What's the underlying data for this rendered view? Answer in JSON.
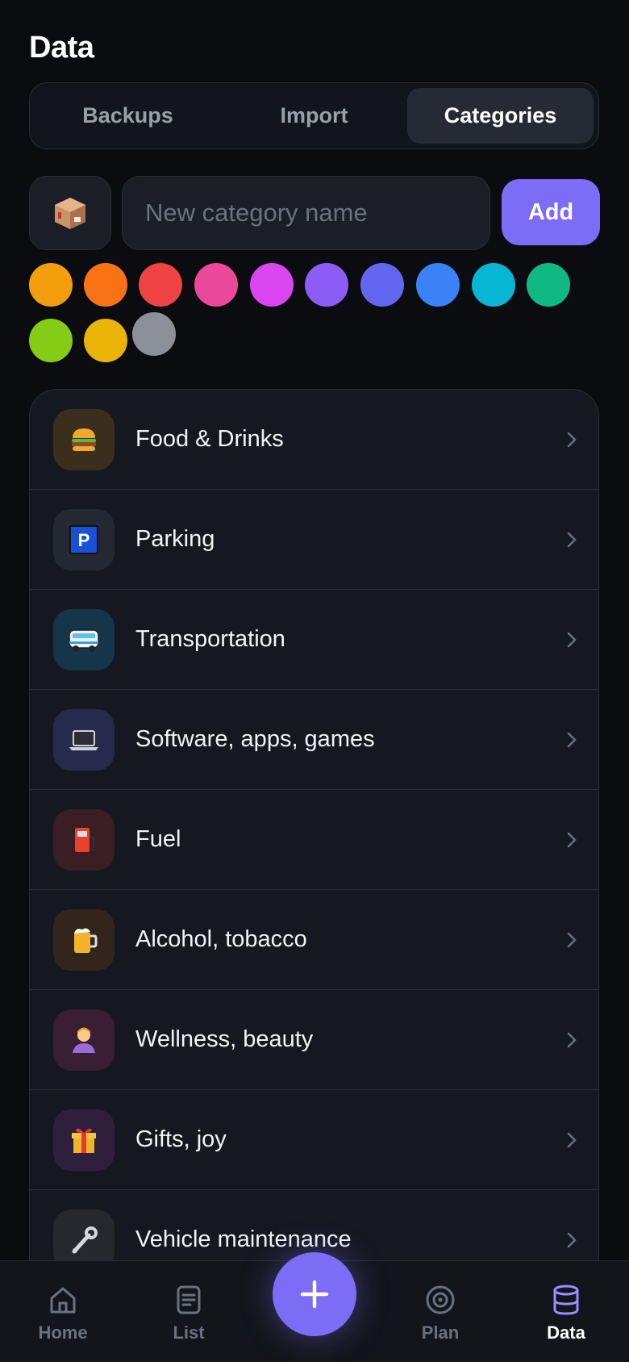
{
  "page": {
    "title": "Data"
  },
  "tabs": [
    {
      "label": "Backups",
      "active": false
    },
    {
      "label": "Import",
      "active": false
    },
    {
      "label": "Categories",
      "active": true
    }
  ],
  "new_category": {
    "emoji_icon": "package-icon",
    "placeholder": "New category name",
    "value": "",
    "add_label": "Add"
  },
  "colors": [
    {
      "hex": "#f59e0b",
      "selected": false
    },
    {
      "hex": "#f97316",
      "selected": false
    },
    {
      "hex": "#ef4444",
      "selected": false
    },
    {
      "hex": "#ec4899",
      "selected": false
    },
    {
      "hex": "#d946ef",
      "selected": false
    },
    {
      "hex": "#8b5cf6",
      "selected": false
    },
    {
      "hex": "#6366f1",
      "selected": false
    },
    {
      "hex": "#3b82f6",
      "selected": false
    },
    {
      "hex": "#06b6d4",
      "selected": false
    },
    {
      "hex": "#10b981",
      "selected": false
    },
    {
      "hex": "#84cc16",
      "selected": false
    },
    {
      "hex": "#eab308",
      "selected": false
    },
    {
      "hex": "#8b9099",
      "selected": true
    }
  ],
  "categories": [
    {
      "label": "Food & Drinks",
      "icon": "burger-icon",
      "bg": "#3a2e1c"
    },
    {
      "label": "Parking",
      "icon": "parking-icon",
      "bg": "#242833"
    },
    {
      "label": "Transportation",
      "icon": "bus-icon",
      "bg": "#15354a"
    },
    {
      "label": "Software, apps, games",
      "icon": "laptop-icon",
      "bg": "#262a4d"
    },
    {
      "label": "Fuel",
      "icon": "fuel-pump-icon",
      "bg": "#3b1e24"
    },
    {
      "label": "Alcohol, tobacco",
      "icon": "beer-mug-icon",
      "bg": "#33251c"
    },
    {
      "label": "Wellness, beauty",
      "icon": "spa-person-icon",
      "bg": "#3a1e33"
    },
    {
      "label": "Gifts, joy",
      "icon": "gift-icon",
      "bg": "#2f1f3d"
    },
    {
      "label": "Vehicle maintenance",
      "icon": "wrench-icon",
      "bg": "#26282d"
    }
  ],
  "bottom_nav": [
    {
      "label": "Home",
      "icon": "home-icon",
      "active": false
    },
    {
      "label": "List",
      "icon": "list-icon",
      "active": false
    },
    {
      "label": "Plan",
      "icon": "target-icon",
      "active": false
    },
    {
      "label": "Data",
      "icon": "database-icon",
      "active": true
    }
  ],
  "fab": {
    "icon": "plus-icon"
  },
  "theme": {
    "accent": "#7c6cf6",
    "background": "#0b0c10",
    "card": "#151820"
  }
}
